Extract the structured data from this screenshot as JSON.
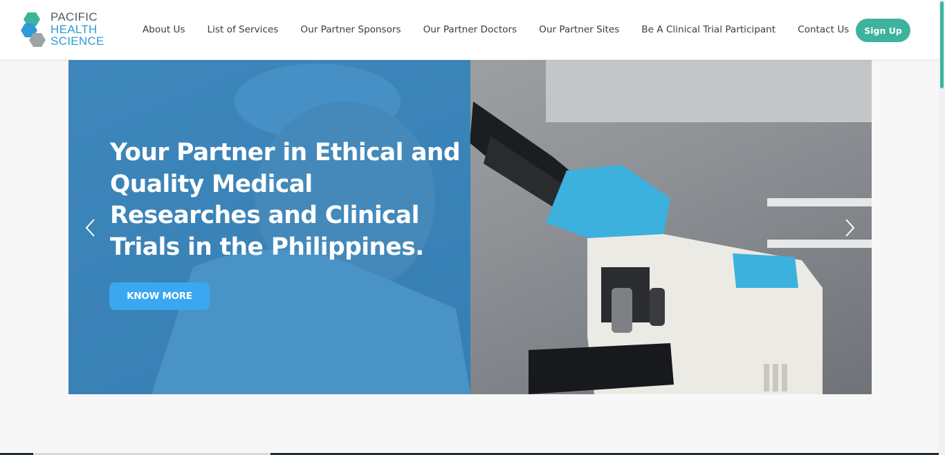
{
  "header": {
    "logo": {
      "line1": "PACIFIC",
      "line2": "HEALTH",
      "line3": "SCIENCE",
      "colors": {
        "line1": "#555b62",
        "line2": "#2f9bd6",
        "line3": "#2f9bd6",
        "hex_teal": "#3db39e",
        "hex_blue": "#2f9bd6",
        "hex_gray": "#9ea3a8"
      }
    },
    "nav": [
      {
        "label": "About Us"
      },
      {
        "label": "List of Services"
      },
      {
        "label": "Our Partner Sponsors"
      },
      {
        "label": "Our Partner Doctors"
      },
      {
        "label": "Our Partner Sites"
      },
      {
        "label": "Be A Clinical Trial Participant"
      },
      {
        "label": "Contact Us"
      }
    ],
    "signup_label": "Sign Up"
  },
  "hero": {
    "headline": "Your Partner in Ethical and Quality Medical Researches and Clinical Trials in the Philippines.",
    "cta_label": "KNOW MORE",
    "prev_icon": "chevron-left-icon",
    "next_icon": "chevron-right-icon"
  },
  "colors": {
    "signup_bg": "#3db39e",
    "cta_bg": "#3aa7f0",
    "overlay": "#237dbe",
    "scroll_thumb": "#3db39e",
    "accent_blue": "#3aa7f0"
  }
}
